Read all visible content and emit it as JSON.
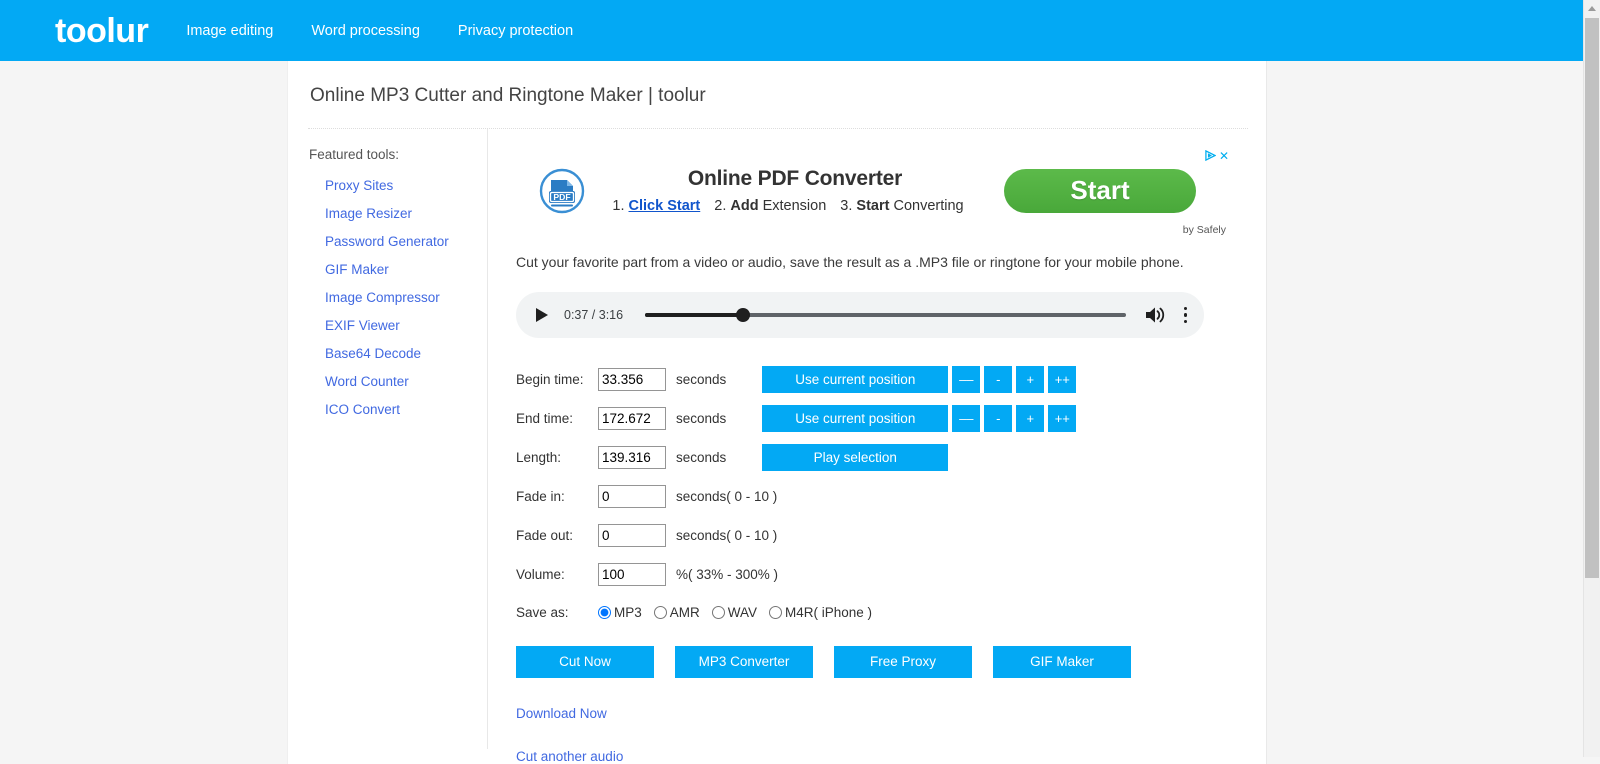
{
  "header": {
    "brand": "toolur",
    "nav": [
      {
        "label": "Image editing"
      },
      {
        "label": "Word processing"
      },
      {
        "label": "Privacy protection"
      }
    ],
    "accent_color": "#03a9f4"
  },
  "page": {
    "title": "Online MP3 Cutter and Ringtone Maker | toolur",
    "description": "Cut your favorite part from a video or audio, save the result as a .MP3 file or ringtone for your mobile phone."
  },
  "sidebar": {
    "heading": "Featured tools:",
    "items": [
      {
        "label": "Proxy Sites"
      },
      {
        "label": "Image Resizer"
      },
      {
        "label": "Password Generator"
      },
      {
        "label": "GIF Maker"
      },
      {
        "label": "Image Compressor"
      },
      {
        "label": "EXIF Viewer"
      },
      {
        "label": "Base64 Decode"
      },
      {
        "label": "Word Counter"
      },
      {
        "label": "ICO Convert"
      }
    ],
    "link_color": "#4169e1"
  },
  "ad": {
    "icon_name": "pdf-document-icon",
    "headline": "Online PDF Converter",
    "step1_num": "1.",
    "step1_link": "Click Start",
    "step2_num": "2.",
    "step2_strong": "Add",
    "step2_rest": "Extension",
    "step3_num": "3.",
    "step3_strong": "Start",
    "step3_rest": "Converting",
    "cta_label": "Start",
    "attribution": "by Safely",
    "close_label": "✕",
    "cta_color": "#4fae3e"
  },
  "player": {
    "state": "paused",
    "current_time": "0:37",
    "total_time": "3:16",
    "time_display": "0:37 / 3:16",
    "progress_percent": 20.4,
    "volume_icon": "volume-high-icon",
    "more_icon": "more-options-icon",
    "play_icon": "play-icon"
  },
  "form": {
    "rows": [
      {
        "label": "Begin time:",
        "value": "33.356",
        "unit": "seconds",
        "action_label": "Use current position",
        "steppers": [
          "––",
          "-",
          "+",
          "++"
        ]
      },
      {
        "label": "End time:",
        "value": "172.672",
        "unit": "seconds",
        "action_label": "Use current position",
        "steppers": [
          "––",
          "-",
          "+",
          "++"
        ]
      },
      {
        "label": "Length:",
        "value": "139.316",
        "unit": "seconds",
        "action_label": "Play selection",
        "steppers": []
      },
      {
        "label": "Fade in:",
        "value": "0",
        "unit": "seconds( 0 - 10 )",
        "action_label": "",
        "steppers": []
      },
      {
        "label": "Fade out:",
        "value": "0",
        "unit": "seconds( 0 - 10 )",
        "action_label": "",
        "steppers": []
      },
      {
        "label": "Volume:",
        "value": "100",
        "unit": "%( 33% - 300% )",
        "action_label": "",
        "steppers": []
      }
    ],
    "save_as": {
      "label": "Save as:",
      "selected": "MP3",
      "options": [
        {
          "label": "MP3",
          "checked": true
        },
        {
          "label": "AMR",
          "checked": false
        },
        {
          "label": "WAV",
          "checked": false
        },
        {
          "label": "M4R( iPhone )",
          "checked": false
        }
      ]
    }
  },
  "actions": [
    {
      "label": "Cut Now"
    },
    {
      "label": "MP3 Converter"
    },
    {
      "label": "Free Proxy"
    },
    {
      "label": "GIF Maker"
    }
  ],
  "bottom_links": [
    {
      "label": "Download Now"
    },
    {
      "label": "Cut another audio"
    }
  ]
}
